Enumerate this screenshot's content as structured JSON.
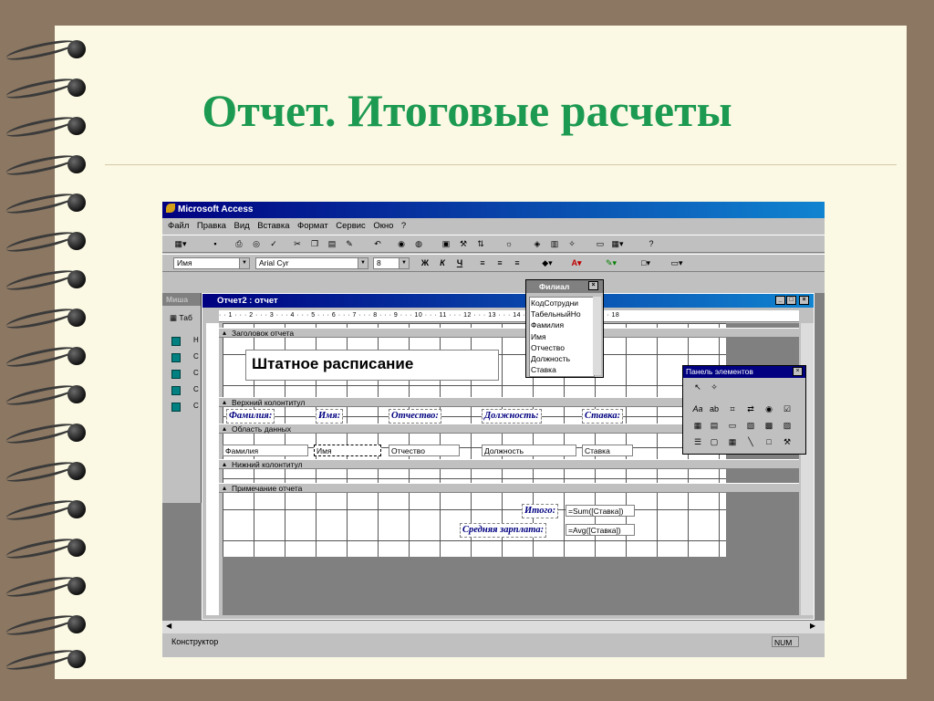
{
  "slide_title": "Отчет. Итоговые расчеты",
  "app": {
    "title": "Microsoft Access",
    "menu": [
      "Файл",
      "Правка",
      "Вид",
      "Вставка",
      "Формат",
      "Сервис",
      "Окно",
      "?"
    ]
  },
  "format_bar": {
    "object_name": "Имя",
    "font_name": "Arial Cyr",
    "font_size": "8",
    "bold": "Ж",
    "italic": "К",
    "underline": "Ч"
  },
  "db_window": {
    "title": "Миша",
    "tab_label": "Таб",
    "items": [
      "Н",
      "С",
      "С",
      "С",
      "С"
    ]
  },
  "report": {
    "window_title": "Отчет2 : отчет",
    "ruler": "· · 1 · · · 2 · · · 3 · · · 4 · · · 5 · · · 6 · · · 7 · · · 8 · · · 9 · · · 10 · · · 11 · · · 12 · · · 13 · · · 14 · · · 15 · · · 16 · · · 17 · · · 18",
    "sections": {
      "report_header": "Заголовок отчета",
      "page_header": "Верхний колонтитул",
      "detail": "Область данных",
      "page_footer": "Нижний колонтитул",
      "report_footer": "Примечание отчета"
    },
    "heading": "Штатное расписание",
    "column_labels": [
      "Фамилия:",
      "Имя:",
      "Отчество:",
      "Должность:",
      "Ставка:"
    ],
    "fields": [
      "Фамилия",
      "Имя",
      "Отчество",
      "Должность",
      "Ставка"
    ],
    "totals": [
      {
        "label": "Итого:",
        "expression": "=Sum([Ставка])"
      },
      {
        "label": "Средняя зарплата:",
        "expression": "=Avg([Ставка])"
      }
    ]
  },
  "field_list": {
    "title": "Филиал",
    "items": [
      "КодСотрудни",
      "ТабельныйНо",
      "Фамилия",
      "Имя",
      "Отчество",
      "Должность",
      "Ставка"
    ]
  },
  "toolbox": {
    "title": "Панель элементов"
  },
  "status": {
    "mode": "Конструктор",
    "num": "NUM"
  }
}
